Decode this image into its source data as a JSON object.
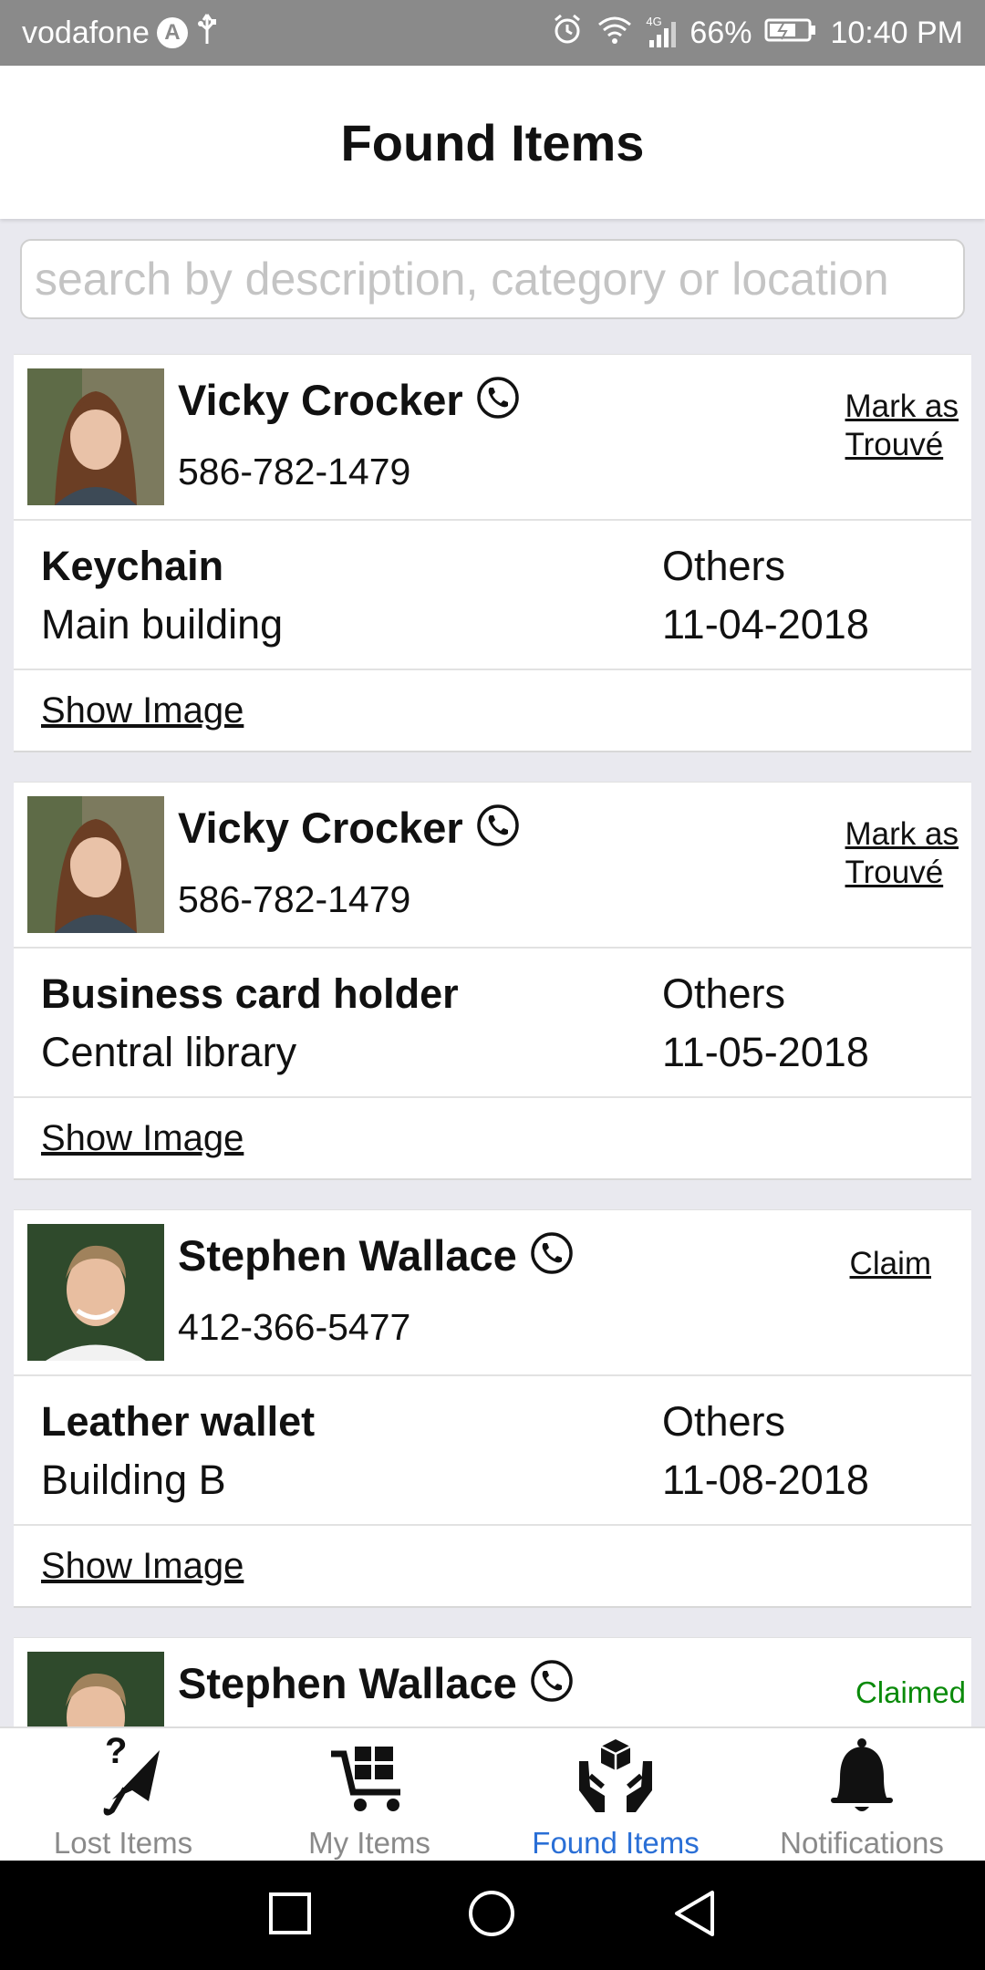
{
  "status_bar": {
    "carrier": "vodafone",
    "carrier_badge": "A",
    "network": "4G",
    "battery": "66%",
    "time": "10:40 PM"
  },
  "header": {
    "title": "Found Items"
  },
  "search": {
    "placeholder": "search by description, category or location"
  },
  "items": [
    {
      "name": "Vicky Crocker",
      "phone": "586-782-1479",
      "action_line1": "Mark as",
      "action_line2": "Trouvé",
      "item": "Keychain",
      "location": "Main building",
      "category": "Others",
      "date": "11-04-2018",
      "link": "Show Image"
    },
    {
      "name": "Vicky Crocker",
      "phone": "586-782-1479",
      "action_line1": "Mark as",
      "action_line2": "Trouvé",
      "item": "Business card holder",
      "location": "Central library",
      "category": "Others",
      "date": "11-05-2018",
      "link": "Show Image"
    },
    {
      "name": "Stephen Wallace",
      "phone": "412-366-5477",
      "action": "Claim",
      "item": "Leather wallet",
      "location": "Building B",
      "category": "Others",
      "date": "11-08-2018",
      "link": "Show Image"
    },
    {
      "name": "Stephen Wallace",
      "status": "Claimed"
    }
  ],
  "bottom_nav": [
    {
      "label": "Lost Items",
      "icon": "lost-items-icon"
    },
    {
      "label": "My Items",
      "icon": "cart-icon"
    },
    {
      "label": "Found Items",
      "icon": "hands-box-icon",
      "active": true
    },
    {
      "label": "Notifications",
      "icon": "bell-icon"
    }
  ],
  "colors": {
    "active": "#2a6fd6",
    "claimed": "#0a8a0a",
    "inactive": "#8a8a8a"
  }
}
